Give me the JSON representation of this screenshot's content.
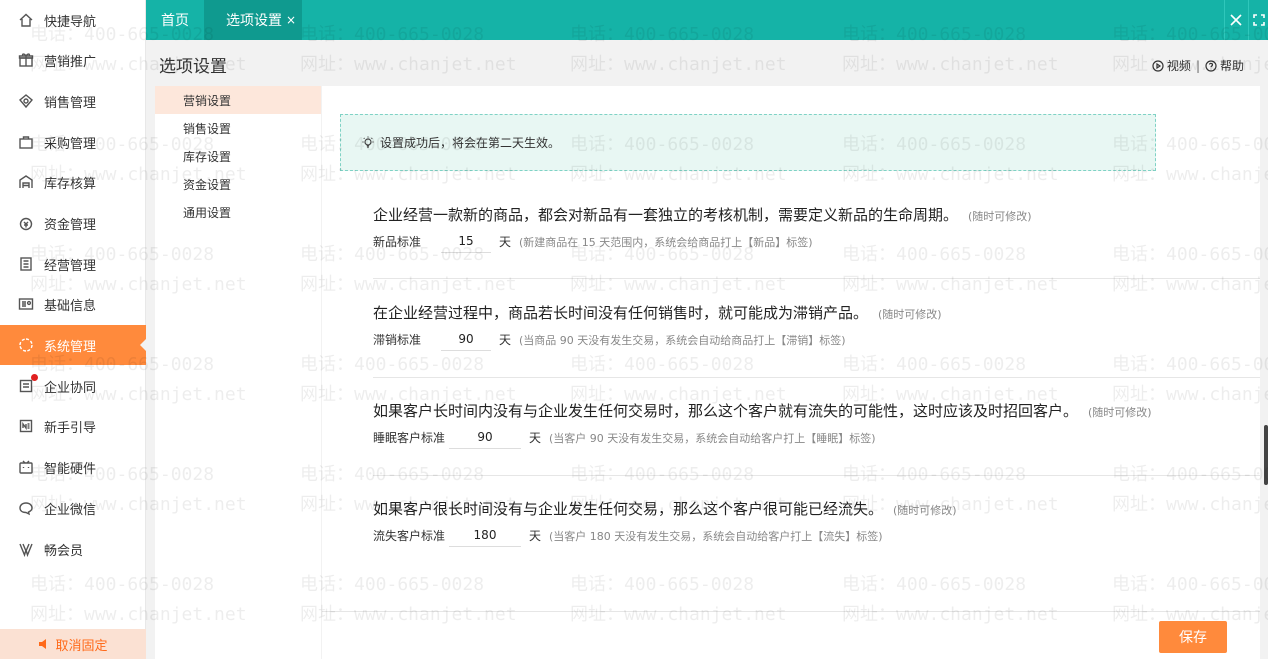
{
  "sidebar": {
    "items": [
      {
        "label": "快捷导航",
        "icon": "home-icon"
      },
      {
        "label": "营销推广",
        "icon": "gift-icon"
      },
      {
        "label": "销售管理",
        "icon": "sales-icon"
      },
      {
        "label": "采购管理",
        "icon": "bag-icon"
      },
      {
        "label": "库存核算",
        "icon": "warehouse-icon"
      },
      {
        "label": "资金管理",
        "icon": "money-icon"
      },
      {
        "label": "经营管理",
        "icon": "report-icon"
      },
      {
        "label": "基础信息",
        "icon": "info-card-icon"
      },
      {
        "label": "系统管理",
        "icon": "settings-icon"
      },
      {
        "label": "企业协同",
        "icon": "collab-icon"
      },
      {
        "label": "新手引导",
        "icon": "guide-icon"
      },
      {
        "label": "智能硬件",
        "icon": "device-icon"
      },
      {
        "label": "企业微信",
        "icon": "chat-icon"
      },
      {
        "label": "畅会员",
        "icon": "vip-icon"
      }
    ],
    "unpin_label": "取消固定"
  },
  "topbar": {
    "home_tab": "首页",
    "current_tab": "选项设置",
    "close_glyph": "×"
  },
  "page": {
    "title": "选项设置",
    "video_link": "视频",
    "separator": "|",
    "help_link": "帮助"
  },
  "submenu": {
    "items": [
      "营销设置",
      "销售设置",
      "库存设置",
      "资金设置",
      "通用设置"
    ]
  },
  "tip": {
    "text": "设置成功后，将会在第二天生效。"
  },
  "settings": [
    {
      "question": "企业经营一款新的商品，都会对新品有一套独立的考核机制，需要定义新品的生命周期。",
      "hint": "(随时可修改)",
      "label": "新品标准",
      "value": "15",
      "unit": "天",
      "desc": "(新建商品在 15 天范围内，系统会给商品打上【新品】标签)"
    },
    {
      "question": "在企业经营过程中，商品若长时间没有任何销售时，就可能成为滞销产品。",
      "hint": "(随时可修改)",
      "label": "滞销标准",
      "value": "90",
      "unit": "天",
      "desc": "(当商品 90 天没有发生交易，系统会自动给商品打上【滞销】标签)"
    },
    {
      "question": "如果客户长时间内没有与企业发生任何交易时，那么这个客户就有流失的可能性，这时应该及时招回客户。",
      "hint": "(随时可修改)",
      "label": "睡眠客户标准",
      "value": "90",
      "unit": "天",
      "desc": "(当客户 90 天没有发生交易，系统会自动给客户打上【睡眠】标签)"
    },
    {
      "question": "如果客户很长时间没有与企业发生任何交易，那么这个客户很可能已经流失。",
      "hint": "(随时可修改)",
      "label": "流失客户标准",
      "value": "180",
      "unit": "天",
      "desc": "(当客户 180 天没有发生交易，系统会自动给客户打上【流失】标签)"
    }
  ],
  "footer": {
    "save_label": "保存"
  },
  "watermark": {
    "phone": "电话：400-665-0028",
    "site": "网址：www.chanjet.net"
  },
  "colors": {
    "accent": "#ff8a3c",
    "topbar": "#15b3a7",
    "tab_active": "#0f9a8f"
  }
}
